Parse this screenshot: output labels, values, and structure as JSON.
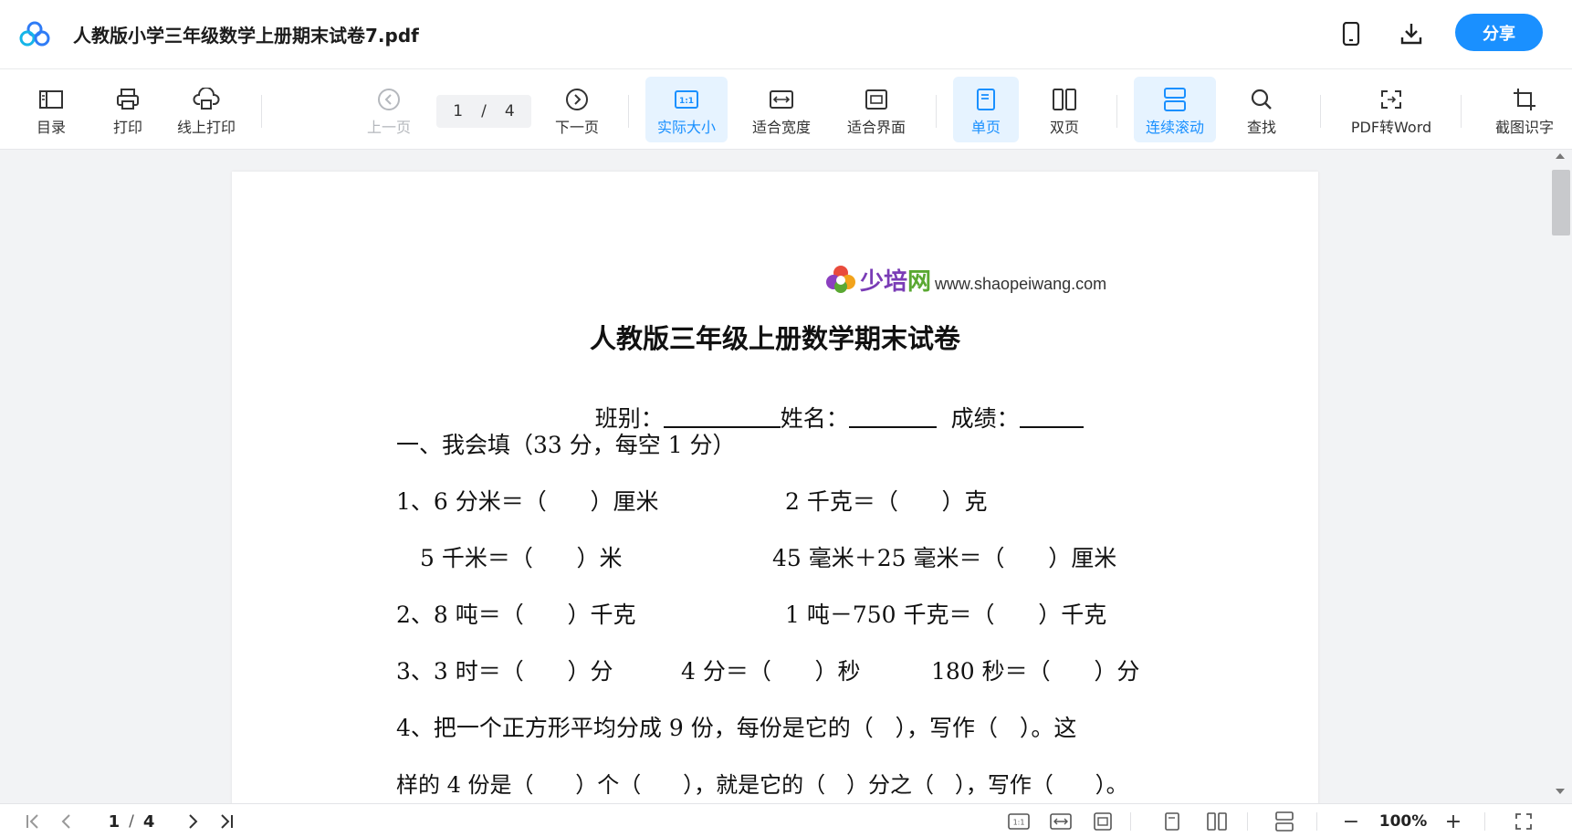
{
  "header": {
    "title": "人教版小学三年级数学上册期末试卷7.pdf",
    "share_label": "分享",
    "icons": [
      "app-logo-icon",
      "mobile-icon",
      "download-icon"
    ],
    "accent_color": "#1a90ff"
  },
  "toolbar": {
    "toc": "目录",
    "print": "打印",
    "online_print": "线上打印",
    "prev": "上一页",
    "page_current": "1",
    "page_sep": "/",
    "page_total": "4",
    "next": "下一页",
    "actual_size": "实际大小",
    "fit_width": "适合宽度",
    "fit_screen": "适合界面",
    "single": "单页",
    "double": "双页",
    "continuous": "连续滚动",
    "find": "查找",
    "pdf_word": "PDF转Word",
    "ocr": "截图识字"
  },
  "document": {
    "brand_name_1": "少培",
    "brand_name_2": "网",
    "brand_url": "www.shaopeiwang.com",
    "title": "人教版三年级上册数学期末试卷",
    "info_class": "班别：",
    "info_name": "姓名：",
    "info_score": "成绩：",
    "section1": "一、我会填（33 分，每空 1 分）",
    "q1a": "1、6 分米＝（      ）厘米",
    "q1b": "2 千克＝（      ）克",
    "q1c": "5 千米＝（      ）米",
    "q1d": "45 毫米＋25 毫米＝（      ）厘米",
    "q2a": "2、8 吨＝（      ）千克",
    "q2b": "1 吨－750 千克＝（      ）千克",
    "q3a": "3、3 时＝（      ）分",
    "q3b": "4 分＝（      ）秒",
    "q3c": "180 秒＝（      ）分",
    "q4": "4、把一个正方形平均分成 9 份，每份是它的（   ），写作（   ）。这",
    "q4b": "样的 4 份是（      ）个（      ），就是它的（   ）分之（   ），写作（      ）。"
  },
  "bottom": {
    "page_current": "1",
    "page_sep": "/",
    "page_total": "4",
    "zoom": "100%",
    "zoom_out": "−",
    "zoom_in": "+"
  }
}
